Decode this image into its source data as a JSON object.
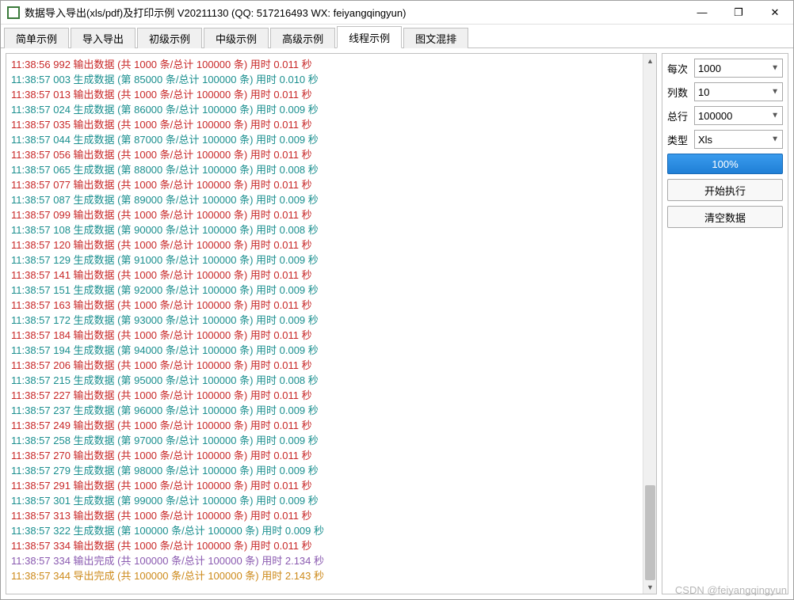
{
  "window": {
    "title": "数据导入导出(xls/pdf)及打印示例 V20211130 (QQ: 517216493 WX: feiyangqingyun)"
  },
  "winbuttons": {
    "minimize": "—",
    "restore": "❐",
    "close": "✕"
  },
  "tabs": [
    {
      "label": "简单示例",
      "active": false
    },
    {
      "label": "导入导出",
      "active": false
    },
    {
      "label": "初级示例",
      "active": false
    },
    {
      "label": "中级示例",
      "active": false
    },
    {
      "label": "高级示例",
      "active": false
    },
    {
      "label": "线程示例",
      "active": true
    },
    {
      "label": "图文混排",
      "active": false
    }
  ],
  "logs": [
    {
      "color": "#c82828",
      "text": "11:38:56 992 输出数据 (共 1000 条/总计 100000 条) 用时 0.011 秒"
    },
    {
      "color": "#1a8f8f",
      "text": "11:38:57 003 生成数据 (第 85000 条/总计 100000 条) 用时 0.010 秒"
    },
    {
      "color": "#c82828",
      "text": "11:38:57 013 输出数据 (共 1000 条/总计 100000 条) 用时 0.011 秒"
    },
    {
      "color": "#1a8f8f",
      "text": "11:38:57 024 生成数据 (第 86000 条/总计 100000 条) 用时 0.009 秒"
    },
    {
      "color": "#c82828",
      "text": "11:38:57 035 输出数据 (共 1000 条/总计 100000 条) 用时 0.011 秒"
    },
    {
      "color": "#1a8f8f",
      "text": "11:38:57 044 生成数据 (第 87000 条/总计 100000 条) 用时 0.009 秒"
    },
    {
      "color": "#c82828",
      "text": "11:38:57 056 输出数据 (共 1000 条/总计 100000 条) 用时 0.011 秒"
    },
    {
      "color": "#1a8f8f",
      "text": "11:38:57 065 生成数据 (第 88000 条/总计 100000 条) 用时 0.008 秒"
    },
    {
      "color": "#c82828",
      "text": "11:38:57 077 输出数据 (共 1000 条/总计 100000 条) 用时 0.011 秒"
    },
    {
      "color": "#1a8f8f",
      "text": "11:38:57 087 生成数据 (第 89000 条/总计 100000 条) 用时 0.009 秒"
    },
    {
      "color": "#c82828",
      "text": "11:38:57 099 输出数据 (共 1000 条/总计 100000 条) 用时 0.011 秒"
    },
    {
      "color": "#1a8f8f",
      "text": "11:38:57 108 生成数据 (第 90000 条/总计 100000 条) 用时 0.008 秒"
    },
    {
      "color": "#c82828",
      "text": "11:38:57 120 输出数据 (共 1000 条/总计 100000 条) 用时 0.011 秒"
    },
    {
      "color": "#1a8f8f",
      "text": "11:38:57 129 生成数据 (第 91000 条/总计 100000 条) 用时 0.009 秒"
    },
    {
      "color": "#c82828",
      "text": "11:38:57 141 输出数据 (共 1000 条/总计 100000 条) 用时 0.011 秒"
    },
    {
      "color": "#1a8f8f",
      "text": "11:38:57 151 生成数据 (第 92000 条/总计 100000 条) 用时 0.009 秒"
    },
    {
      "color": "#c82828",
      "text": "11:38:57 163 输出数据 (共 1000 条/总计 100000 条) 用时 0.011 秒"
    },
    {
      "color": "#1a8f8f",
      "text": "11:38:57 172 生成数据 (第 93000 条/总计 100000 条) 用时 0.009 秒"
    },
    {
      "color": "#c82828",
      "text": "11:38:57 184 输出数据 (共 1000 条/总计 100000 条) 用时 0.011 秒"
    },
    {
      "color": "#1a8f8f",
      "text": "11:38:57 194 生成数据 (第 94000 条/总计 100000 条) 用时 0.009 秒"
    },
    {
      "color": "#c82828",
      "text": "11:38:57 206 输出数据 (共 1000 条/总计 100000 条) 用时 0.011 秒"
    },
    {
      "color": "#1a8f8f",
      "text": "11:38:57 215 生成数据 (第 95000 条/总计 100000 条) 用时 0.008 秒"
    },
    {
      "color": "#c82828",
      "text": "11:38:57 227 输出数据 (共 1000 条/总计 100000 条) 用时 0.011 秒"
    },
    {
      "color": "#1a8f8f",
      "text": "11:38:57 237 生成数据 (第 96000 条/总计 100000 条) 用时 0.009 秒"
    },
    {
      "color": "#c82828",
      "text": "11:38:57 249 输出数据 (共 1000 条/总计 100000 条) 用时 0.011 秒"
    },
    {
      "color": "#1a8f8f",
      "text": "11:38:57 258 生成数据 (第 97000 条/总计 100000 条) 用时 0.009 秒"
    },
    {
      "color": "#c82828",
      "text": "11:38:57 270 输出数据 (共 1000 条/总计 100000 条) 用时 0.011 秒"
    },
    {
      "color": "#1a8f8f",
      "text": "11:38:57 279 生成数据 (第 98000 条/总计 100000 条) 用时 0.009 秒"
    },
    {
      "color": "#c82828",
      "text": "11:38:57 291 输出数据 (共 1000 条/总计 100000 条) 用时 0.011 秒"
    },
    {
      "color": "#1a8f8f",
      "text": "11:38:57 301 生成数据 (第 99000 条/总计 100000 条) 用时 0.009 秒"
    },
    {
      "color": "#c82828",
      "text": "11:38:57 313 输出数据 (共 1000 条/总计 100000 条) 用时 0.011 秒"
    },
    {
      "color": "#1a8f8f",
      "text": "11:38:57 322 生成数据 (第 100000 条/总计 100000 条) 用时 0.009 秒"
    },
    {
      "color": "#c82828",
      "text": "11:38:57 334 输出数据 (共 1000 条/总计 100000 条) 用时 0.011 秒"
    },
    {
      "color": "#8a5ab0",
      "text": "11:38:57 334 输出完成 (共 100000 条/总计 100000 条) 用时 2.134 秒"
    },
    {
      "color": "#cd8a1b",
      "text": "11:38:57 344 导出完成 (共 100000 条/总计 100000 条) 用时 2.143 秒"
    }
  ],
  "form": {
    "per_label": "每次",
    "per_value": "1000",
    "cols_label": "列数",
    "cols_value": "10",
    "rows_label": "总行",
    "rows_value": "100000",
    "type_label": "类型",
    "type_value": "Xls",
    "progress_label": "100%",
    "start_label": "开始执行",
    "clear_label": "清空数据"
  },
  "watermark": "CSDN @feiyangqingyun"
}
